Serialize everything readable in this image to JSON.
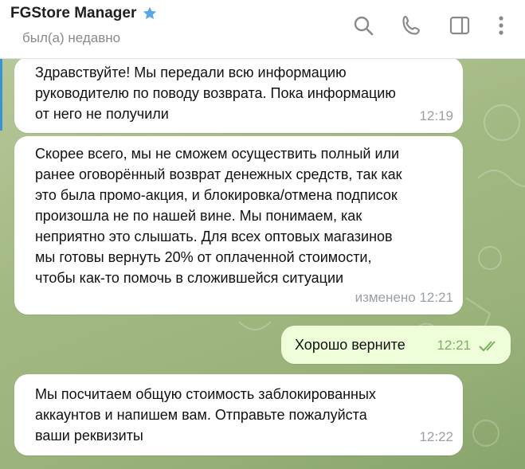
{
  "header": {
    "title": "FGStore Manager",
    "status": "был(а) недавно",
    "icons": [
      "verified-star-icon",
      "search-icon",
      "phone-icon",
      "sidebar-toggle-icon",
      "more-vertical-icon"
    ]
  },
  "messages": [
    {
      "direction": "incoming",
      "lines": [
        "Здравствуйте! Мы передали всю информацию",
        "руководителю по поводу возврата. Пока информацию",
        "от него не получили"
      ],
      "time": "12:19"
    },
    {
      "direction": "incoming",
      "lines": [
        "Скорее всего, мы не сможем осуществить полный или",
        "ранее оговорённый возврат денежных средств, так как",
        "это была промо-акция, и блокировка/отмена подписок",
        "произошла не по нашей вине. Мы понимаем, как",
        "неприятно это слышать. Для всех оптовых магазинов",
        "мы готовы вернуть 20% от оплаченной стоимости,",
        "чтобы как-то помочь в сложившейся ситуации"
      ],
      "time": "изменено 12:21"
    },
    {
      "direction": "outgoing",
      "lines": [
        "Хорошо верните"
      ],
      "time": "12:21",
      "read": true
    },
    {
      "direction": "incoming",
      "lines": [
        "Мы посчитаем общую стоимость заблокированных",
        "аккаунтов и напишем вам. Отправьте пожалуйста",
        "ваши реквизиты"
      ],
      "time": "12:22"
    }
  ],
  "colors": {
    "accent": "#3a91d6",
    "outgoing_bubble": "#eefed9",
    "check": "#7ab15f"
  }
}
